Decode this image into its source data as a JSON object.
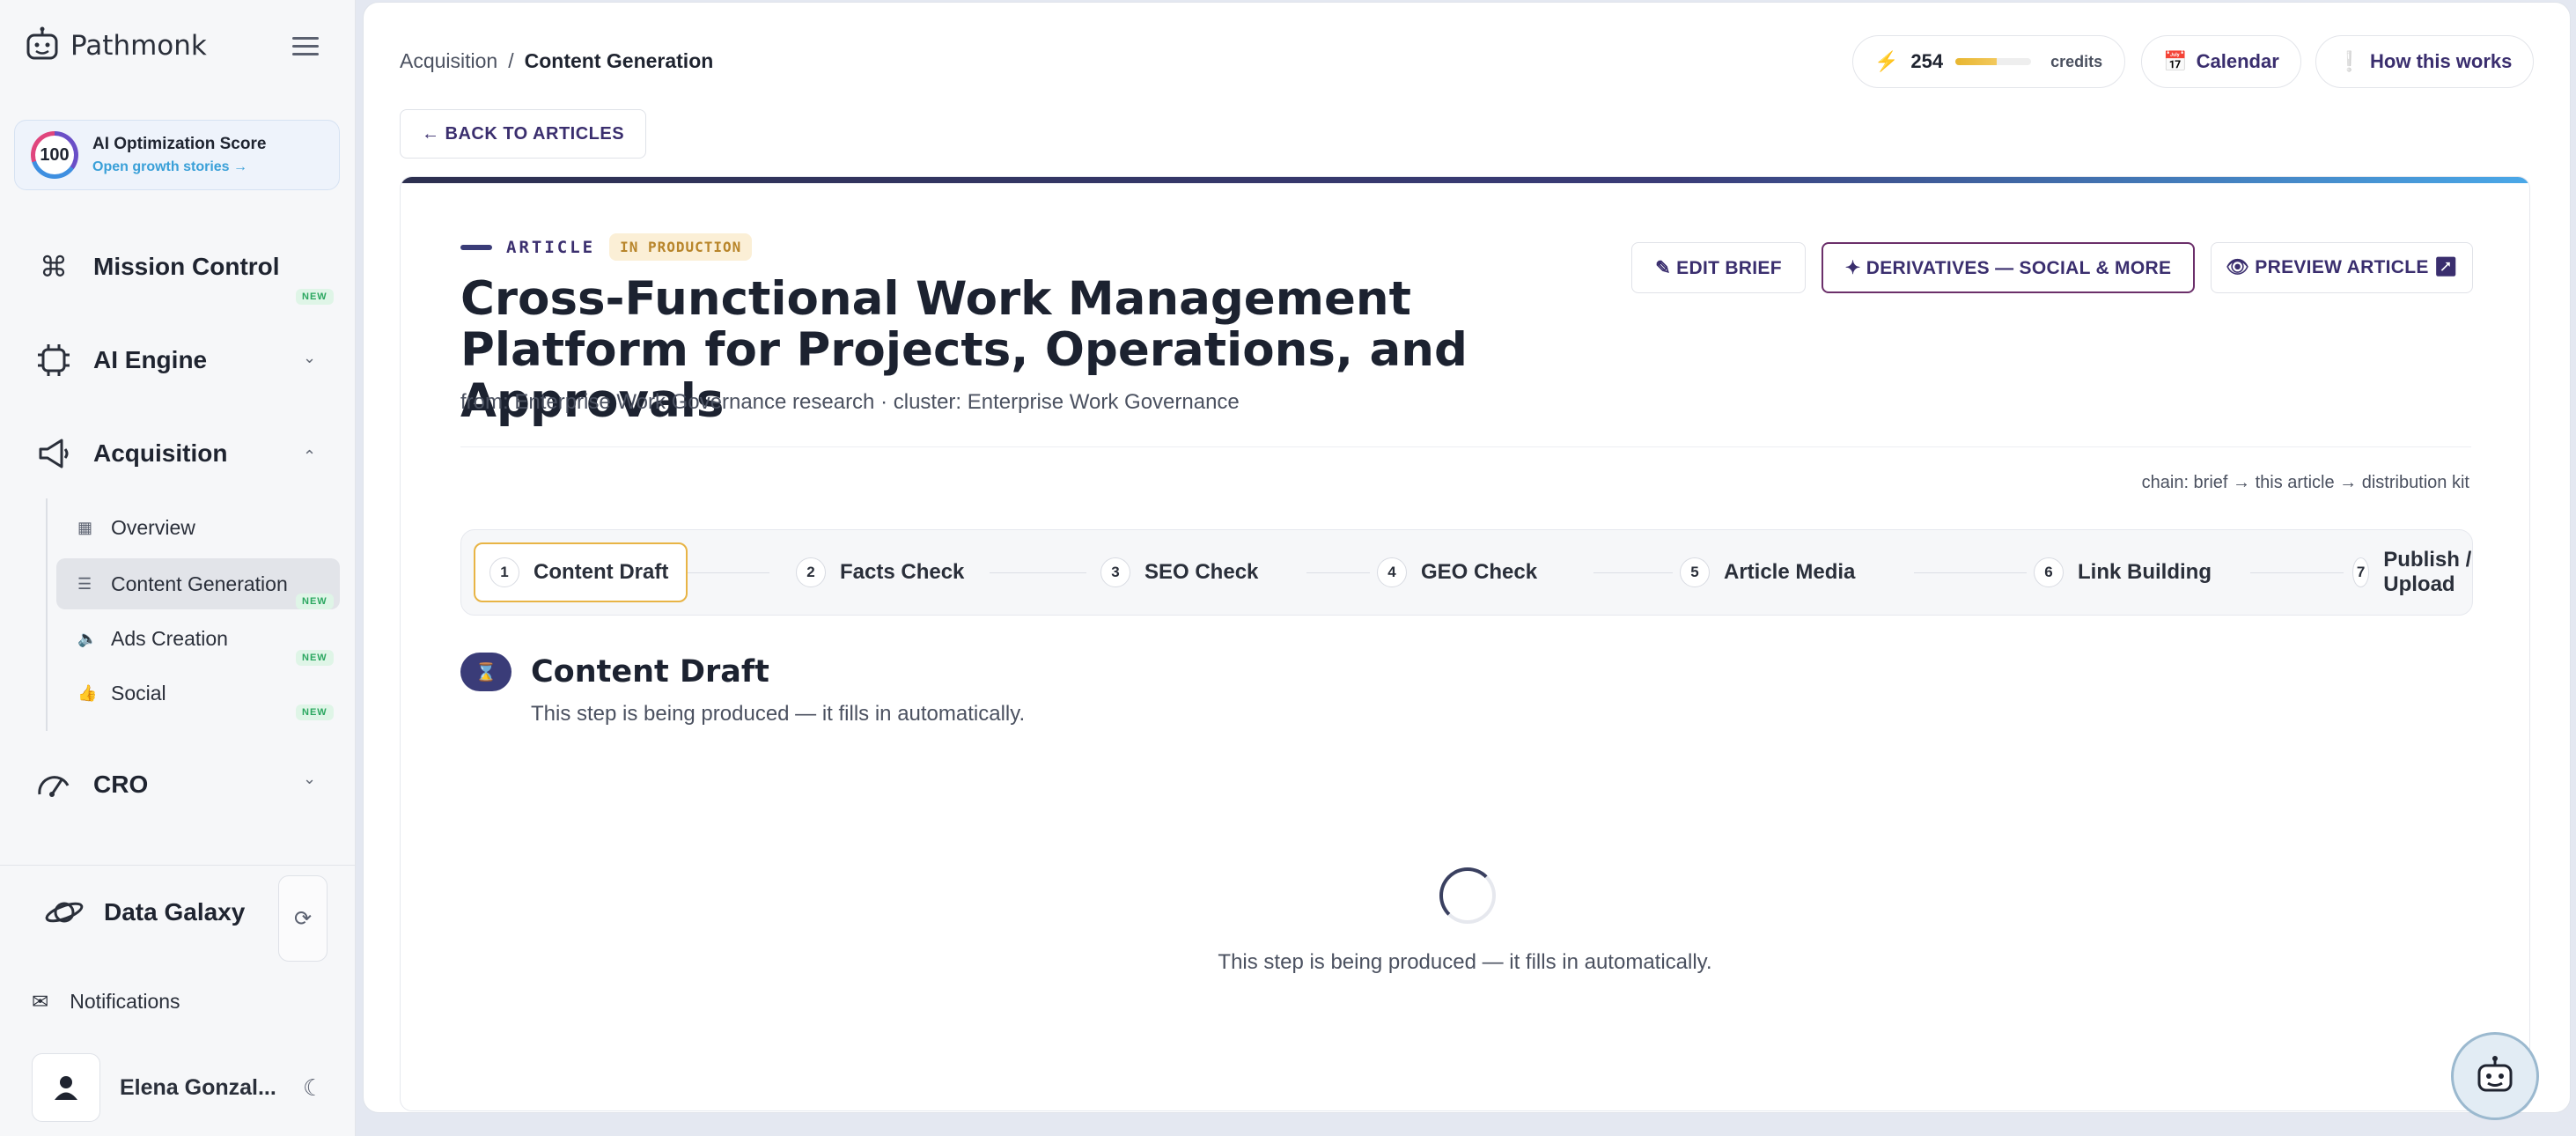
{
  "brand": {
    "name": "Pathmonk"
  },
  "score_card": {
    "score": "100",
    "title": "AI Optimization Score",
    "link": "Open growth stories →"
  },
  "sidebar": {
    "mission_control": "Mission Control",
    "ai_engine": "AI Engine",
    "acquisition": "Acquisition",
    "acquisition_items": [
      {
        "label": "Overview"
      },
      {
        "label": "Content Generation"
      },
      {
        "label": "Ads Creation"
      },
      {
        "label": "Social"
      }
    ],
    "cro": "CRO",
    "new_badge": "NEW",
    "data_galaxy": "Data Galaxy",
    "notifications": "Notifications",
    "user_name": "Elena Gonzal..."
  },
  "breadcrumb": {
    "parent": "Acquisition",
    "separator": "/",
    "current": "Content Generation"
  },
  "header": {
    "credits_value": "254",
    "credits_label": "credits",
    "credits_fraction": 0.55,
    "calendar": "Calendar",
    "how_it_works": "How this works"
  },
  "back_button": "← BACK TO ARTICLES",
  "article": {
    "kind": "ARTICLE",
    "status": "IN PRODUCTION",
    "title": "Cross-Functional Work Management Platform for Projects, Operations, and Approvals",
    "source": "from: Enterprise Work Governance research · cluster: Enterprise Work Governance",
    "actions": {
      "edit_brief": "✎ EDIT BRIEF",
      "derivatives": "✦ DERIVATIVES — SOCIAL & MORE",
      "preview": "👁 PREVIEW ARTICLE ↗"
    },
    "chain": "chain: brief → this article → distribution kit"
  },
  "steps": [
    {
      "num": "1",
      "label": "Content Draft"
    },
    {
      "num": "2",
      "label": "Facts Check"
    },
    {
      "num": "3",
      "label": "SEO Check"
    },
    {
      "num": "4",
      "label": "GEO Check"
    },
    {
      "num": "5",
      "label": "Article Media"
    },
    {
      "num": "6",
      "label": "Link Building"
    },
    {
      "num": "7",
      "label": "Publish / Upload"
    }
  ],
  "section": {
    "title": "Content Draft",
    "subtitle": "This step is being produced — it fills in automatically.",
    "loading_text": "This step is being produced — it fills in automatically."
  },
  "colors": {
    "accent": "#3a2e6e",
    "status": "#b8852a",
    "new": "#2ba760"
  }
}
